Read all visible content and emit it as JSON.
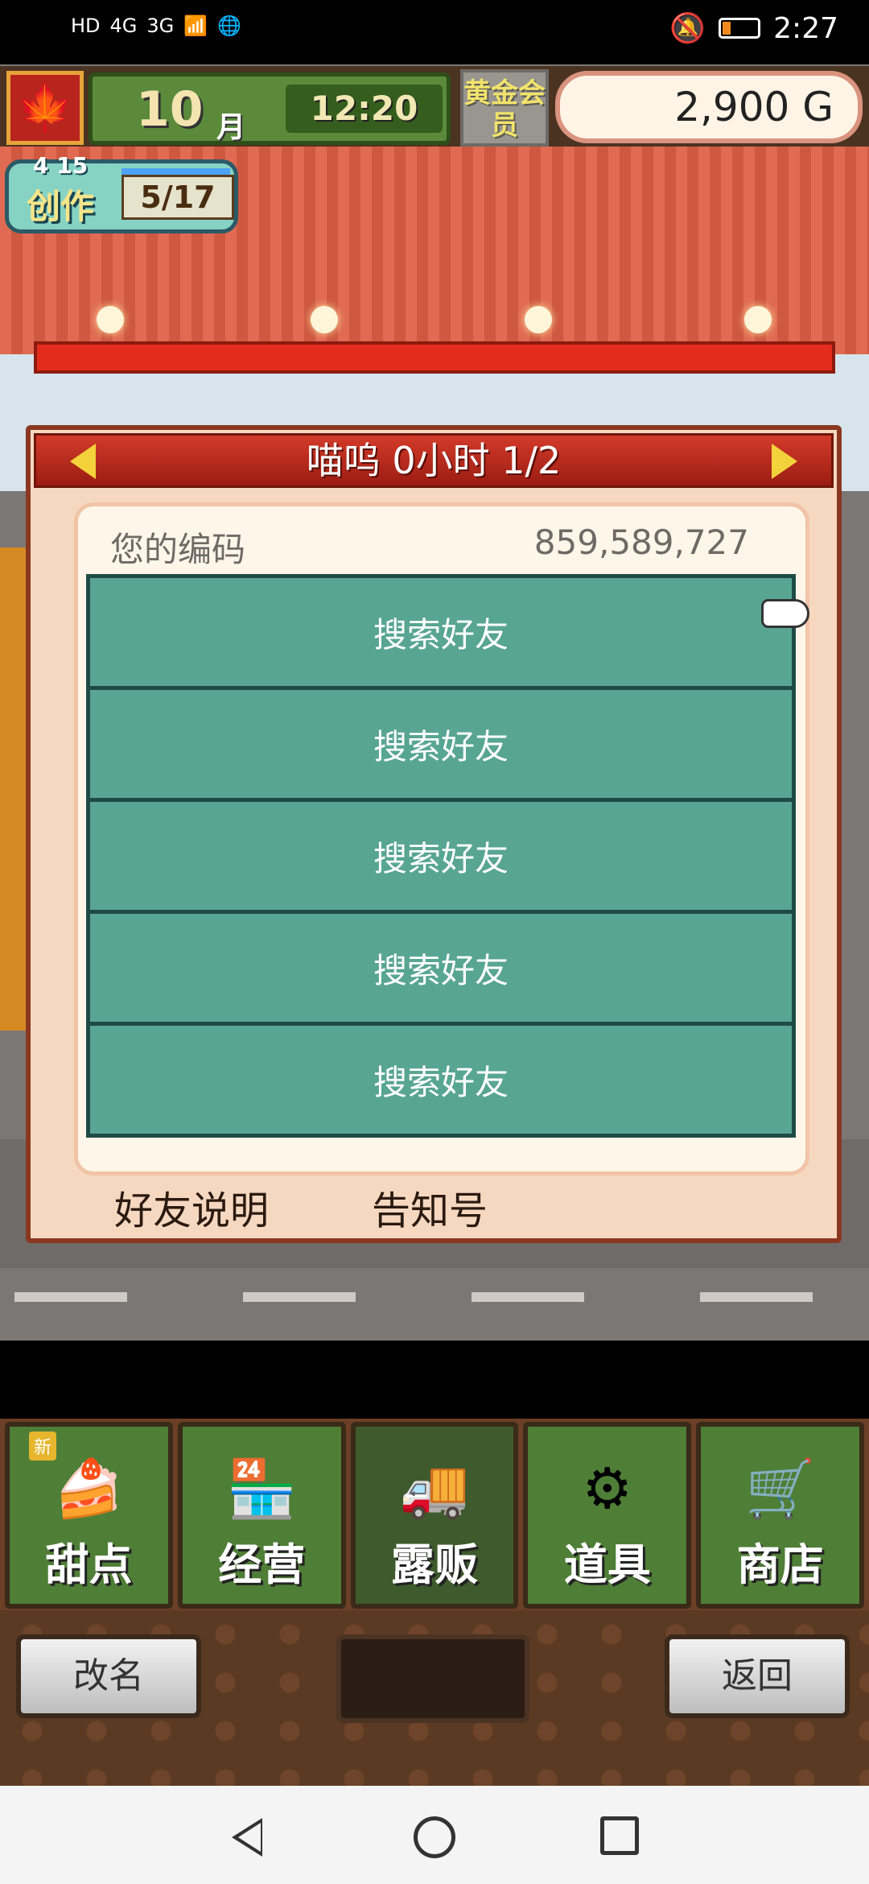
{
  "status_bar": {
    "left_indicators": [
      "HD",
      "4G",
      "3G",
      "wifi",
      "app"
    ],
    "time": "2:27"
  },
  "hud": {
    "month_number": "10",
    "month_unit": "月",
    "time": "12:20",
    "gold_member": "黄金会员",
    "money": "2,900 G",
    "create_label": "创作",
    "create_date": "4 15",
    "create_count": "5/17"
  },
  "dialog": {
    "title": "喵呜  0小时 1/2",
    "code_label": "您的编码",
    "code_value": "859,589,727",
    "friend_rows": [
      "搜索好友",
      "搜索好友",
      "搜索好友",
      "搜索好友",
      "搜索好友"
    ],
    "footer_left": "好友说明",
    "footer_right": "告知号"
  },
  "menu": {
    "items": [
      {
        "label": "甜点",
        "icon": "cake-icon",
        "new": "新"
      },
      {
        "label": "经营",
        "icon": "shop-icon"
      },
      {
        "label": "露贩",
        "icon": "food-truck-icon"
      },
      {
        "label": "道具",
        "icon": "tools-icon"
      },
      {
        "label": "商店",
        "icon": "cart-icon"
      }
    ]
  },
  "bottom": {
    "rename": "改名",
    "back": "返回"
  },
  "colors": {
    "friend_row": "#58a593",
    "title_bar": "#c1301f",
    "menu_green": "#4f7e37"
  }
}
